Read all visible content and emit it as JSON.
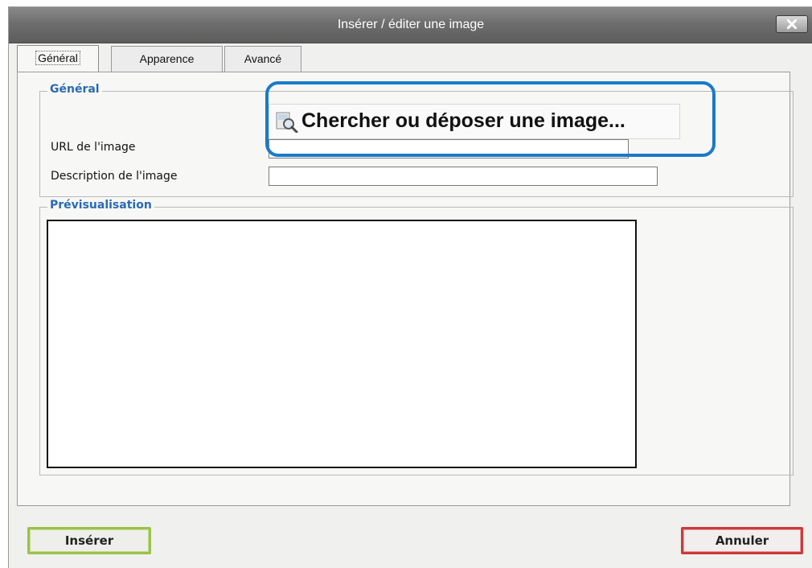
{
  "window": {
    "title": "Insérer / éditer une image",
    "close_icon": "close-icon"
  },
  "tabs": [
    {
      "label": "Général",
      "active": true
    },
    {
      "label": "Apparence",
      "active": false
    },
    {
      "label": "Avancé",
      "active": false
    }
  ],
  "general": {
    "legend": "Général",
    "browse_label": "Chercher ou déposer une image...",
    "browse_icon": "image-search-icon",
    "url_label": "URL de l'image",
    "url_value": "",
    "description_label": "Description de l'image",
    "description_value": ""
  },
  "preview": {
    "legend": "Prévisualisation"
  },
  "buttons": {
    "insert": "Insérer",
    "cancel": "Annuler"
  },
  "colors": {
    "legend": "#2a6ab2",
    "highlight": "#1a7ac8",
    "insert_border": "#9ac24a",
    "cancel_border": "#cc3a3a"
  }
}
